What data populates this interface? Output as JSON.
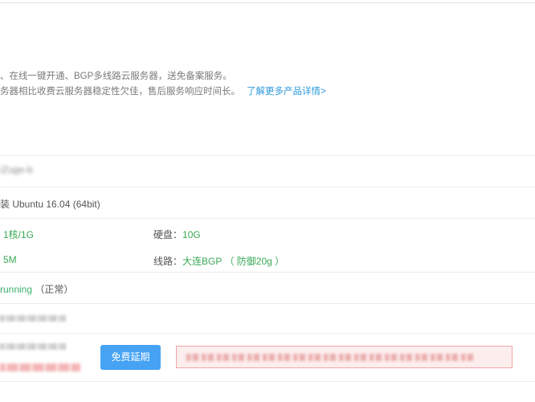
{
  "description": {
    "line1": "、在线一键开通、BGP多线路云服务器，送免备案服务。",
    "line2": "务器相比收费云服务器稳定性欠佳，售后服务响应时间长。",
    "more_link": "了解更多产品详情>"
  },
  "server": {
    "name_blurred": "iZuge-b",
    "os": "装 Ubuntu 16.04 (64bit)",
    "cpu_mem_value": "1核/1G",
    "disk_label": "硬盘：",
    "disk_value": "10G",
    "bandwidth_value": "5M",
    "line_label": "线路：",
    "line_value": "大连BGP （ 防御20g ）",
    "status_value": "running",
    "status_note": "（正常）"
  },
  "actions": {
    "extend_button": "免费延期"
  },
  "colors": {
    "accent": "#46a3f4",
    "link": "#2d9bdb",
    "green": "#3aa957",
    "alert_bg": "#fdeeee",
    "alert_border": "#f1a4a4"
  }
}
